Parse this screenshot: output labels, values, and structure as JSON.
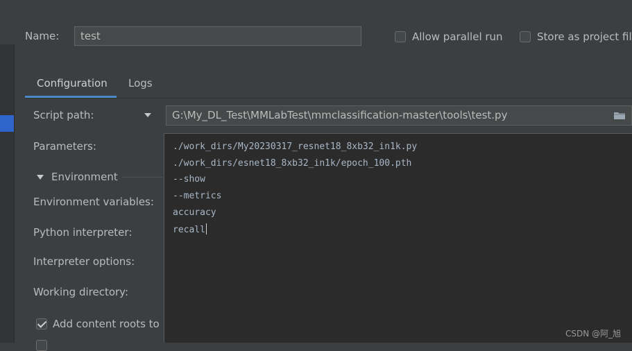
{
  "name": {
    "label": "Name:",
    "value": "test"
  },
  "options": {
    "allow_parallel": "Allow parallel run",
    "store_project": "Store as project file"
  },
  "tabs": [
    "Configuration",
    "Logs"
  ],
  "form": {
    "script_path_label": "Script path:",
    "script_path_value": "G:\\My_DL_Test\\MMLabTest\\mmclassification-master\\tools\\test.py",
    "parameters_label": "Parameters:",
    "environment_section": "Environment",
    "env_vars_label": "Environment variables:",
    "python_interp_label": "Python interpreter:",
    "interp_options_label": "Interpreter options:",
    "working_dir_label": "Working directory:",
    "add_content_roots_label": "Add content roots to"
  },
  "parameters_lines": [
    "./work_dirs/My20230317_resnet18_8xb32_in1k.py",
    "./work_dirs/esnet18_8xb32_in1k/epoch_100.pth",
    "--show",
    "--metrics",
    "accuracy",
    "recall"
  ],
  "watermark": "CSDN @阿_旭",
  "icons": {
    "folder": "folder-icon",
    "dropdown": "chevron-down-icon",
    "check": "check-icon"
  }
}
